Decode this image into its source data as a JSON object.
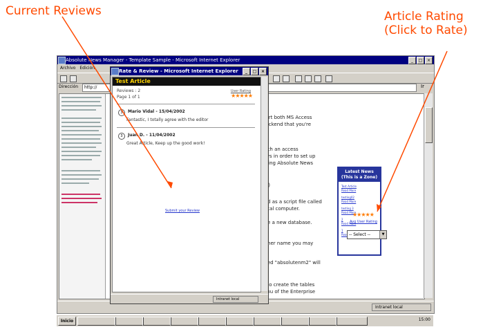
{
  "annotations": {
    "current_reviews": "Current Reviews",
    "article_rating_line1": "Article Rating",
    "article_rating_line2": "(Click to Rate)"
  },
  "main_window": {
    "title": "Absolute News Manager - Template Sample - Microsoft Internet Explorer",
    "menu": [
      "Archivo",
      "Edición"
    ],
    "address_label": "Dirección",
    "address_value": "http://",
    "go_label": "Ir",
    "status_zone": "Intranet local"
  },
  "content": {
    "body_lines": [
      "port both MS Access",
      "backend that you're",
      "with an access",
      "ows in order to set up",
      "alling Absolute News",
      "ile)",
      "ted as a script file called",
      "local computer.",
      "ate a new database.",
      "other name you may",
      "med \"absolutenm2\" will",
      "e to create the tables",
      "lenu of the Enterprise"
    ],
    "news_box": {
      "title_line1": "Latest News",
      "title_line2": "(This is a Zone)",
      "links": [
        "Test Article",
        "Read More",
        "testing02",
        "Read More",
        "testing 3",
        "Read More",
        "2",
        "Read More",
        "1",
        "Read More"
      ]
    },
    "rating_stars": "★★★★★",
    "rating_link": "Avg User Rating",
    "select_value": "-- Select --"
  },
  "popup": {
    "title": "Rate & Review - Microsoft Internet Explorer",
    "header": "Test Article",
    "reviews_count": "Reviews : 2",
    "page_count": "Page 1 of 1",
    "user_rating_label": "User Rating",
    "user_rating_stars": "★★★★★",
    "reviews": [
      {
        "author": "Mario Vidal - 15/04/2002",
        "text": "Fantastic, I totally agree with the editor"
      },
      {
        "author": "Juan D. - 11/04/2002",
        "text": "Great Article, Keep up the good work!"
      }
    ],
    "submit_link": "Submit your Review",
    "status_zone": "Intranet local"
  },
  "taskbar": {
    "start": "Inicio",
    "clock": "15:00"
  },
  "colors": {
    "annotation": "#ff4a00",
    "title_bar": "#000080",
    "popup_header_bg": "#111111",
    "popup_header_text": "#ffd400",
    "stars": "#ff7a00",
    "link": "#2233cc"
  }
}
